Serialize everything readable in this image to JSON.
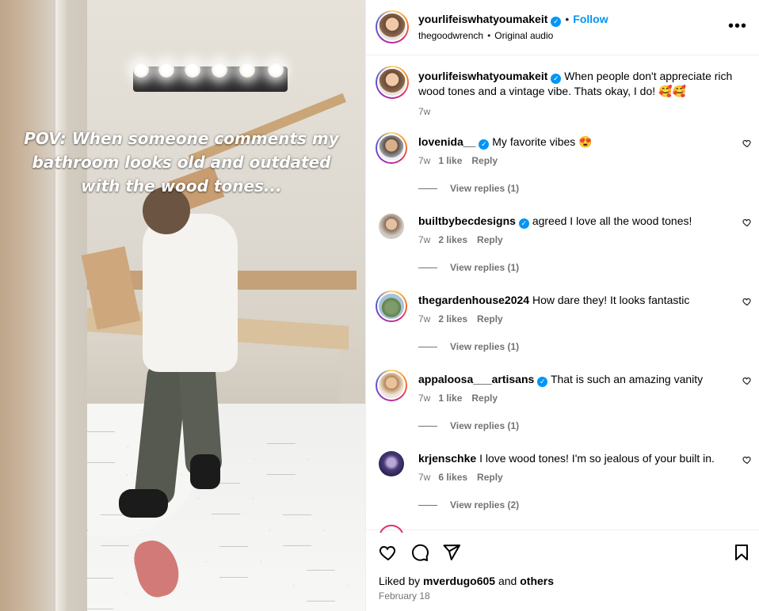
{
  "video": {
    "overlay_text": "POV: When someone comments my bathroom looks old and outdated with the wood tones..."
  },
  "header": {
    "username": "yourlifeiswhatyoumakeit",
    "follow_label": "Follow",
    "separator": "•",
    "audio_user": "thegoodwrench",
    "audio_label": "Original audio",
    "more_icon": "more-horizontal-icon"
  },
  "caption": {
    "username": "yourlifeiswhatyoumakeit",
    "text": "When people don't appreciate rich wood tones and a vintage vibe. Thats okay, I do! 🥰🥰",
    "time": "7w"
  },
  "comments": [
    {
      "username": "lovenida__",
      "verified": true,
      "text": "My favorite vibes 😍",
      "time": "7w",
      "likes": "1 like",
      "reply": "Reply",
      "view_replies": "View replies (1)"
    },
    {
      "username": "builtbybecdesigns",
      "verified": true,
      "text": "agreed I love all the wood tones!",
      "time": "7w",
      "likes": "2 likes",
      "reply": "Reply",
      "view_replies": "View replies (1)"
    },
    {
      "username": "thegardenhouse2024",
      "verified": false,
      "text": "How dare they! It looks fantastic",
      "time": "7w",
      "likes": "2 likes",
      "reply": "Reply",
      "view_replies": "View replies (1)"
    },
    {
      "username": "appaloosa___artisans",
      "verified": true,
      "text": "That is such an amazing vanity",
      "time": "7w",
      "likes": "1 like",
      "reply": "Reply",
      "view_replies": "View replies (1)"
    },
    {
      "username": "krjenschke",
      "verified": false,
      "text": "I love wood tones! I'm so jealous of your built in.",
      "time": "7w",
      "likes": "6 likes",
      "reply": "Reply",
      "view_replies": "View replies (2)"
    }
  ],
  "footer": {
    "liked_by_prefix": "Liked by",
    "liked_by_user": "mverdugo605",
    "liked_by_and": "and",
    "liked_by_others": "others",
    "date": "February 18"
  },
  "colors": {
    "accent": "#0095f6",
    "muted": "#737373",
    "border": "#efefef"
  }
}
